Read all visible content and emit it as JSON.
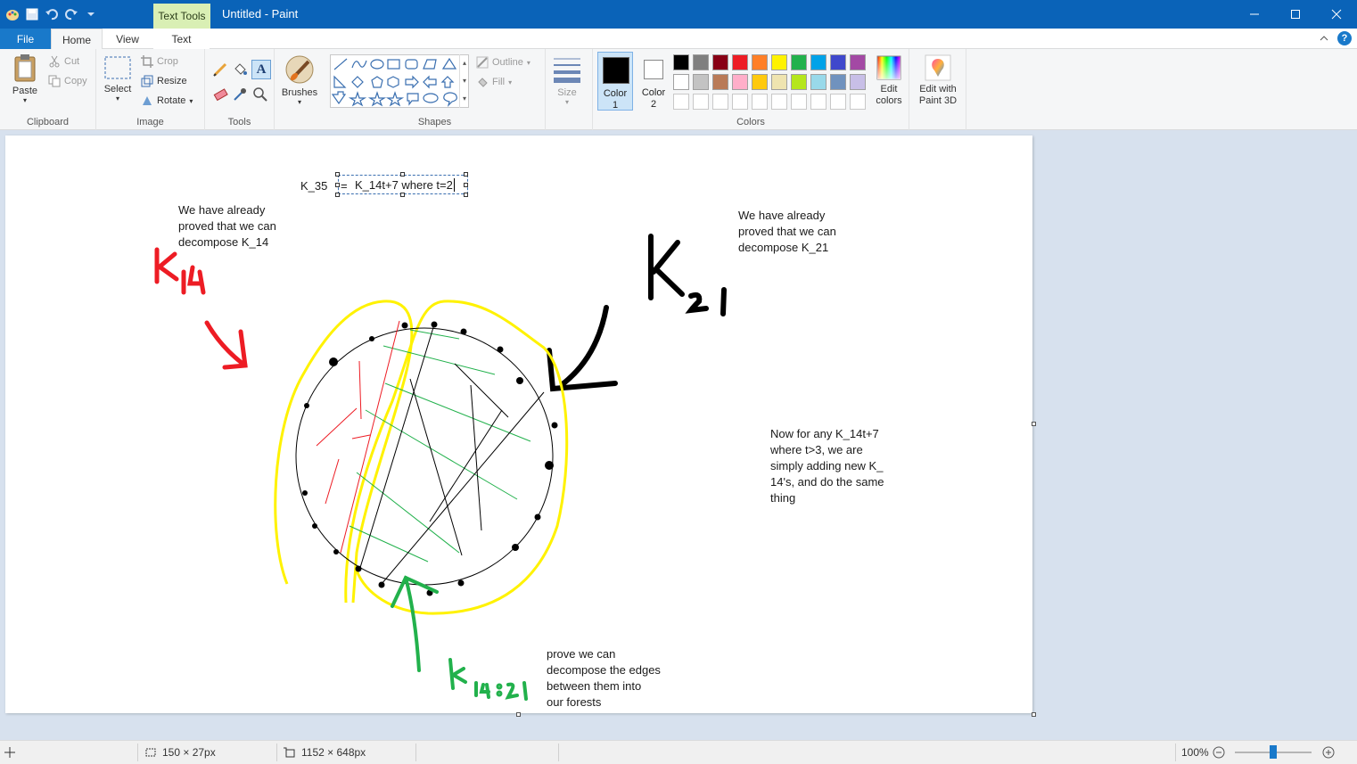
{
  "window": {
    "title": "Untitled - Paint",
    "context_tab": "Text Tools"
  },
  "tabs": {
    "file": "File",
    "home": "Home",
    "view": "View",
    "text": "Text"
  },
  "ribbon": {
    "clipboard": {
      "label": "Clipboard",
      "paste": "Paste",
      "cut": "Cut",
      "copy": "Copy"
    },
    "image": {
      "label": "Image",
      "select": "Select",
      "crop": "Crop",
      "resize": "Resize",
      "rotate": "Rotate"
    },
    "tools": {
      "label": "Tools",
      "brushes": "Brushes"
    },
    "shapes": {
      "label": "Shapes",
      "outline": "Outline",
      "fill": "Fill"
    },
    "size": {
      "label": "Size"
    },
    "colors": {
      "label": "Colors",
      "color1": "Color",
      "color1_num": "1",
      "color2": "Color",
      "color2_num": "2",
      "edit_colors_line1": "Edit",
      "edit_colors_line2": "colors",
      "paint3d_line1": "Edit with",
      "paint3d_line2": "Paint 3D",
      "row1": [
        "#000000",
        "#7f7f7f",
        "#880015",
        "#ed1c24",
        "#ff7f27",
        "#fff200",
        "#22b14c",
        "#00a2e8",
        "#3f48cc",
        "#a349a4"
      ],
      "row2": [
        "#ffffff",
        "#c3c3c3",
        "#b97a57",
        "#ffaec9",
        "#ffc90e",
        "#efe4b0",
        "#b5e61d",
        "#99d9ea",
        "#7092be",
        "#c8bfe7"
      ]
    }
  },
  "canvas_text": {
    "k35": "K_35",
    "eq": "=",
    "textbox": "K_14t+7 where t=2",
    "left_note": "We have already\nproved that we can\ndecompose K_14",
    "right_note": "We have already\nproved that we can\ndecompose K_21",
    "general_note": "Now for any K_14t+7\nwhere t>3, we are\nsimply adding new K_\n14's, and do the same\nthing",
    "bottom_note": "prove we can\ndecompose the edges\nbetween them into\nour forests"
  },
  "status": {
    "selection_size": "150 × 27px",
    "canvas_size": "1152 × 648px",
    "zoom": "100%"
  }
}
